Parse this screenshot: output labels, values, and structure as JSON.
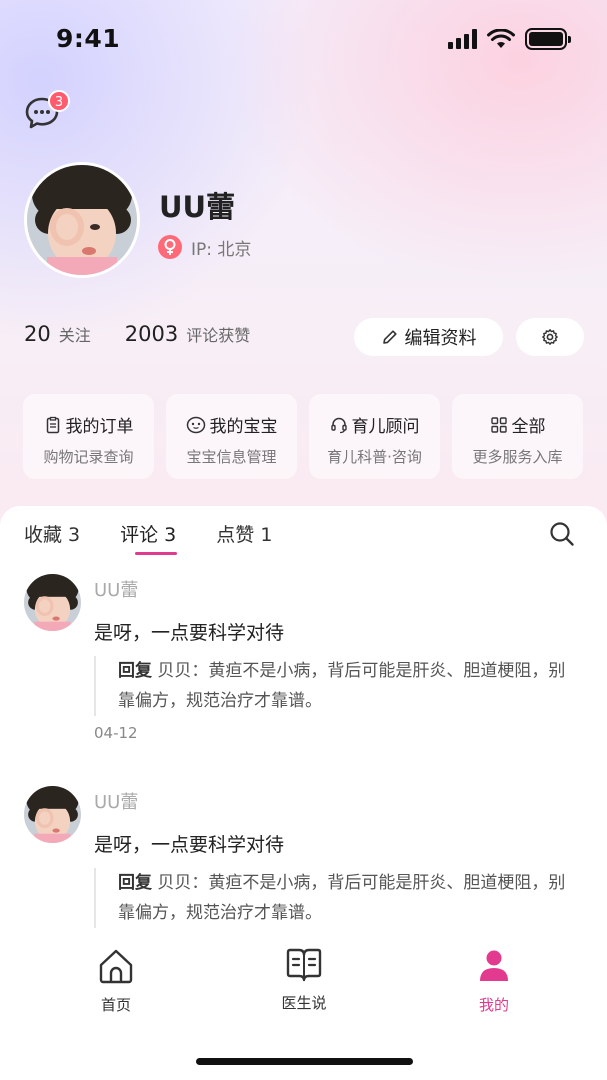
{
  "status_bar": {
    "time": "9:41"
  },
  "message": {
    "badge": "3",
    "icon": "chat-bubble-icon"
  },
  "profile": {
    "name": "UU蕾",
    "gender_icon": "female-icon",
    "ip_label": "IP: 北京",
    "stats": [
      {
        "num": "20",
        "label": "关注"
      },
      {
        "num": "2003",
        "label": "评论获赞"
      }
    ],
    "edit_label": "编辑资料",
    "settings_icon": "gear-icon"
  },
  "services": [
    {
      "title": "我的订单",
      "sub": "购物记录查询",
      "icon": "clipboard-icon"
    },
    {
      "title": "我的宝宝",
      "sub": "宝宝信息管理",
      "icon": "baby-face-icon"
    },
    {
      "title": "育儿顾问",
      "sub": "育儿科普·咨询",
      "icon": "headset-icon"
    },
    {
      "title": "全部",
      "sub": "更多服务入库",
      "icon": "grid-icon"
    }
  ],
  "tabs": [
    {
      "label": "收藏 3",
      "active": false
    },
    {
      "label": "评论 3",
      "active": true
    },
    {
      "label": "点赞 1",
      "active": false
    }
  ],
  "comments": [
    {
      "user": "UU蕾",
      "text": "是呀，一点要科学对待",
      "reply_prefix": "回复",
      "reply_text": "贝贝：黄疸不是小病，背后可能是肝炎、胆道梗阻，别靠偏方，规范治疗才靠谱。",
      "date": "04-12"
    },
    {
      "user": "UU蕾",
      "text": "是呀，一点要科学对待",
      "reply_prefix": "回复",
      "reply_text": "贝贝：黄疸不是小病，背后可能是肝炎、胆道梗阻，别靠偏方，规范治疗才靠谱。",
      "date": ""
    }
  ],
  "tabbar": [
    {
      "label": "首页",
      "icon": "home-icon",
      "active": false
    },
    {
      "label": "医生说",
      "icon": "book-icon",
      "active": false
    },
    {
      "label": "我的",
      "icon": "person-icon",
      "active": true
    }
  ],
  "colors": {
    "accent": "#e23a8f",
    "badge": "#ff5a6e"
  }
}
